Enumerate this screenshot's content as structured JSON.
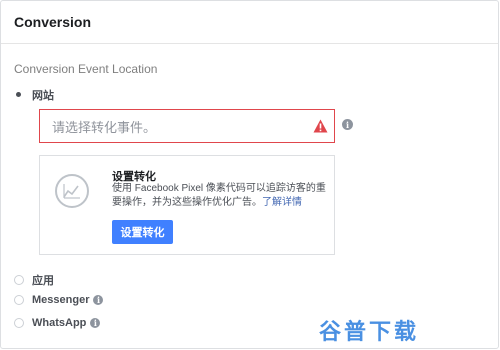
{
  "panel": {
    "title": "Conversion",
    "section_label": "Conversion Event Location"
  },
  "options": [
    {
      "label": "网站",
      "selected": true
    },
    {
      "label": "应用",
      "selected": false
    },
    {
      "label": "Messenger",
      "selected": false,
      "has_info": true
    },
    {
      "label": "WhatsApp",
      "selected": false,
      "has_info": true
    }
  ],
  "event_input": {
    "placeholder": "请选择转化事件。",
    "state": "error"
  },
  "setup": {
    "title": "设置转化",
    "description": "使用 Facebook Pixel 像素代码可以追踪访客的重要操作，并为这些操作优化广告。",
    "learn_more": "了解详情",
    "button_label": "设置转化"
  },
  "watermark": "谷普下载",
  "colors": {
    "error": "#e0464c",
    "primary_button": "#4080ff",
    "link": "#4267b2",
    "watermark": "#4a90e2"
  },
  "icons": {
    "warning": "warning-triangle-icon",
    "info": "info-icon",
    "chart": "line-chart-icon"
  }
}
